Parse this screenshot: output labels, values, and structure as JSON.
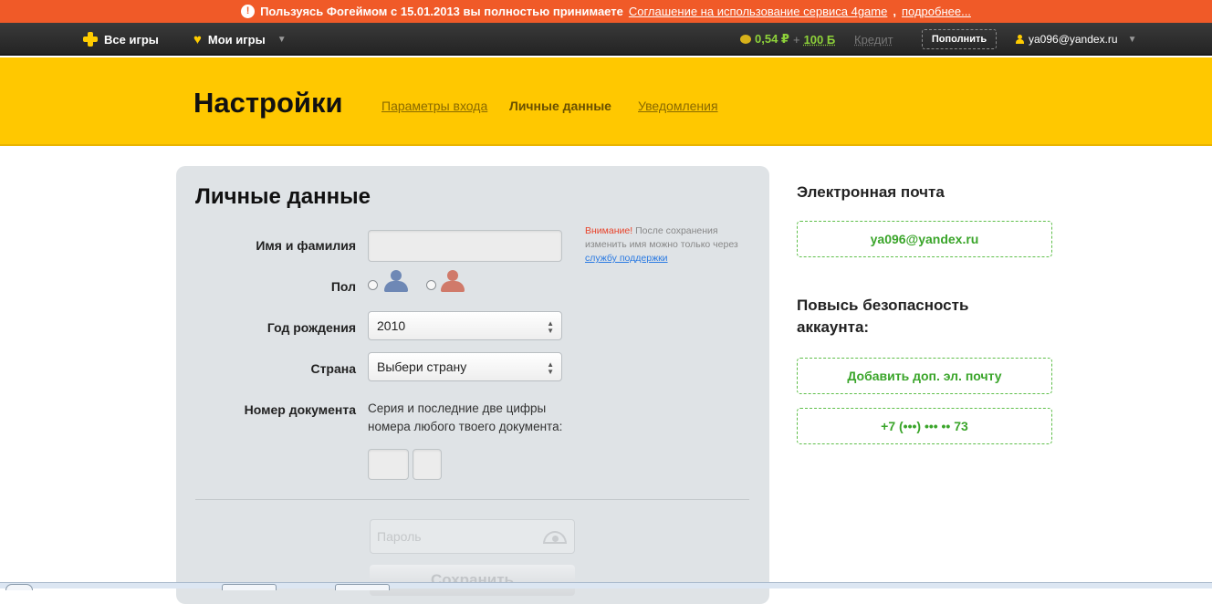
{
  "notice": {
    "text": "Пользуясь Фогеймом с 15.01.2013 вы полностью принимаете",
    "link": "Соглашение на использование сервиса 4game",
    "more": "подробнее..."
  },
  "nav": {
    "all_games": "Все игры",
    "my_games": "Мои игры",
    "balance": "0,54 ₽",
    "plus": "+",
    "bonus": "100 Б",
    "credit": "Кредит",
    "topup": "Пополнить",
    "user": "ya096@yandex.ru"
  },
  "header": {
    "title": "Настройки",
    "tabs": [
      {
        "label": "Параметры входа",
        "active": false
      },
      {
        "label": "Личные данные",
        "active": true
      },
      {
        "label": "Уведомления",
        "active": false
      }
    ]
  },
  "form": {
    "title": "Личные данные",
    "name_label": "Имя и фамилия",
    "name_value": "",
    "gender_label": "Пол",
    "birth_label": "Год рождения",
    "birth_value": "2010",
    "country_label": "Страна",
    "country_value": "Выбери страну",
    "doc_label": "Номер документа",
    "doc_hint_line1": "Серия и последние две цифры",
    "doc_hint_line2": "номера любого твоего документа:",
    "note_warn": "Внимание!",
    "note_text": "После сохранения изменить имя можно только через",
    "note_link": "службу поддержки",
    "password_placeholder": "Пароль",
    "save_label": "Сохранить"
  },
  "side": {
    "email_title": "Электронная почта",
    "email_value": "ya096@yandex.ru",
    "security_title_line1": "Повысь безопасность",
    "security_title_line2": "аккаунта:",
    "add_email": "Добавить доп. эл. почту",
    "phone": "+7 (•••) ••• •• 73"
  },
  "colors": {
    "notice_bg": "#f05a28",
    "header_bg": "#ffc800",
    "accent_green": "#3aa52a",
    "panel_bg": "#dfe3e6"
  }
}
